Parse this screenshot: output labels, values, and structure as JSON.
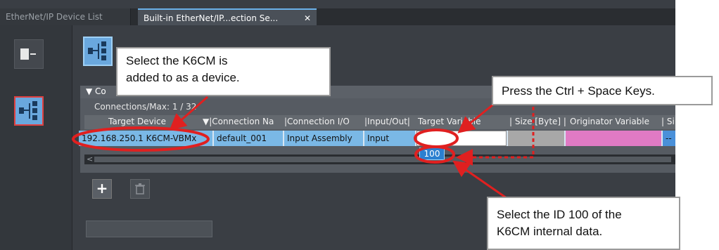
{
  "tabs": [
    {
      "label": "EtherNet/IP Device List",
      "active": false
    },
    {
      "label": "Built-in EtherNet/IP...ection Se...",
      "active": true
    }
  ],
  "tab_close_glyph": "✕",
  "connections": {
    "section_title": "▼ Co",
    "max_line": "Connections/Max: 1 / 32",
    "columns": [
      "Target Device",
      "▼|Connection Na",
      "|Connection I/O",
      "|Input/Out|",
      "Target Variable",
      "| Size [Byte] |",
      "Originator Variable",
      "| Si"
    ],
    "rows": [
      {
        "target_device": "192.168.250.1 K6CM-VBMx",
        "connection_name": "default_001",
        "connection_io": "Input Assembly",
        "direction": "Input",
        "target_variable": "",
        "size": "",
        "originator_variable": "",
        "last": "--"
      }
    ]
  },
  "id_popup": "100",
  "buttons": {
    "add": "+",
    "delete": ""
  },
  "callouts": {
    "select_k6cm": [
      "Select the K6CM is",
      "added to as a device."
    ],
    "press_keys": "Press the Ctrl + Space Keys.",
    "select_id": [
      "Select the ID 100 of the",
      "K6CM internal data."
    ]
  },
  "colors": {
    "annotation": "#e02020",
    "selection_blue": "#7ab8e6",
    "originator_pink": "#e07ac4"
  },
  "icons": [
    "device-icon",
    "network-tree-icon",
    "trash-icon",
    "plus-icon",
    "close-icon"
  ]
}
